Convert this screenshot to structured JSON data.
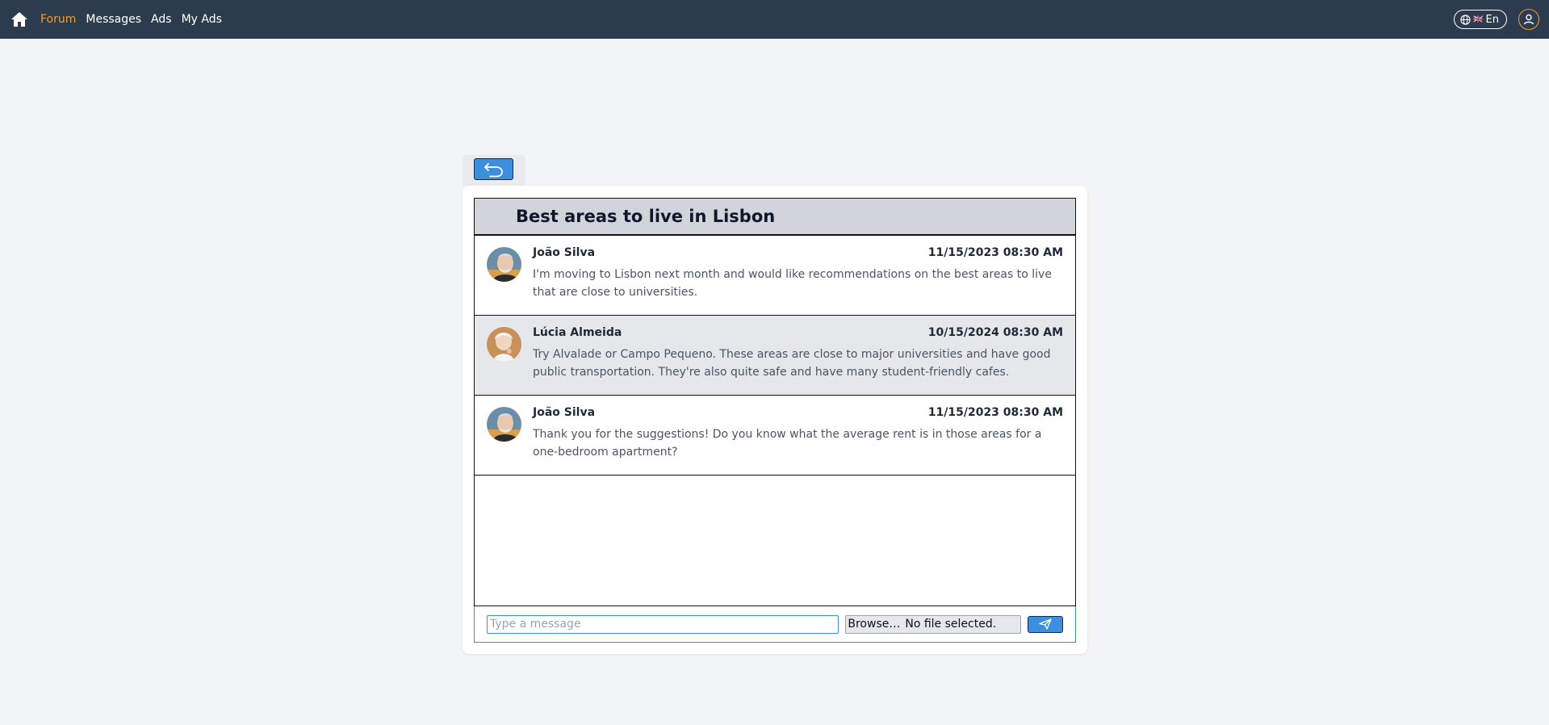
{
  "nav": {
    "links": [
      {
        "label": "Forum",
        "active": true
      },
      {
        "label": "Messages",
        "active": false
      },
      {
        "label": "Ads",
        "active": false
      },
      {
        "label": "My Ads",
        "active": false
      }
    ],
    "language": {
      "flag": "🇬🇧",
      "label": "En"
    },
    "icons": {
      "home": "home-icon",
      "globe": "globe-icon",
      "user": "user-circle-icon"
    }
  },
  "thread": {
    "title": "Best areas to live in Lisbon",
    "messages": [
      {
        "author": "João Silva",
        "date": "11/15/2023 08:30 AM",
        "text": "I'm moving to Lisbon next month and would like recommendations on the best areas to live that are close to universities."
      },
      {
        "author": "Lúcia Almeida",
        "date": "10/15/2024 08:30 AM",
        "text": "Try Alvalade or Campo Pequeno. These areas are close to major universities and have good public transportation. They're also quite safe and have many student-friendly cafes."
      },
      {
        "author": "João Silva",
        "date": "11/15/2023 08:30 AM",
        "text": "Thank you for the suggestions! Do you know what the average rent is in those areas for a one-bedroom apartment?"
      }
    ]
  },
  "composer": {
    "placeholder": "Type a message",
    "browse_label": "Browse…",
    "file_status": "No file selected."
  },
  "colors": {
    "navbar": "#2d3b4e",
    "accent": "#f0a030",
    "button": "#3b8fdc",
    "page_bg": "#f3f4f6"
  }
}
